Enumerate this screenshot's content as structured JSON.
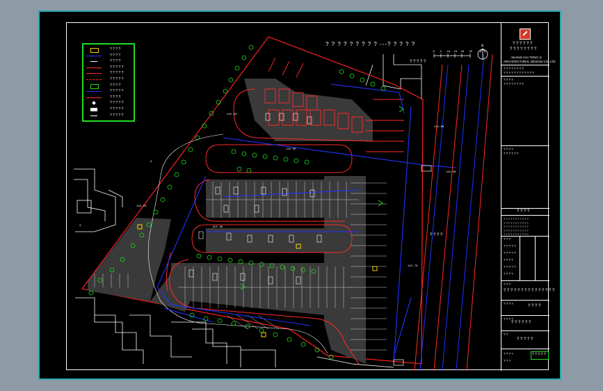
{
  "drawing": {
    "title_line": "? ? ? ? ? ? ? ? ?  ---? ? ? ? ?",
    "scale_labels": [
      "0",
      "5",
      "10",
      "15",
      "20",
      "25"
    ],
    "north_label": "N",
    "road_label_left": "? ? ? ? ?",
    "road_label_right": "? ? ? ?"
  },
  "legend": {
    "items": [
      {
        "sym": "yellow-car",
        "text": "? ? ? ?"
      },
      {
        "sym": "blue-line",
        "text": "? ? ? ?"
      },
      {
        "sym": "white-text",
        "text": "? ? ? ?"
      },
      {
        "sym": "red-line",
        "text": "? ? ? ? ?"
      },
      {
        "sym": "red-line",
        "text": "? ? ? ? ?"
      },
      {
        "sym": "red-dash",
        "text": "? ? ? ? ?"
      },
      {
        "sym": "green-car",
        "text": "? ? ? ?"
      },
      {
        "sym": "blue-line",
        "text": "? ? ? ? ?"
      },
      {
        "sym": "red-small",
        "text": "? ? ? ?"
      },
      {
        "sym": "white-diamond",
        "text": "? ? ? ? ?"
      },
      {
        "sym": "white-rect",
        "text": "? ? ? ? ?"
      },
      {
        "sym": "white-text",
        "text": "? ? ? ? ?"
      }
    ]
  },
  "title_block": {
    "company_line1": "? ? ? ? ? ?",
    "company_line2": "? ? ? ? ? ? ? ?",
    "company_en": "SHANG HAI  TONG JI",
    "company_en2": "ARCHITECTURAL DESIGN CO.,LTD",
    "cert_line1": "? ? ? ? ? ? ? ?",
    "cert_line2": "? ? ? ? ? ? ? ? ? ? ? ?",
    "cert_no": "? ? ? ?",
    "cert_no2": "? ? ? ?   ? ? ? ?",
    "project_label": "? ? ? ?",
    "project_value": "? ? ? ? ? ?",
    "sign_header": "? ? ? ?",
    "sign_rows": [
      "? ? ? ? ? ? ? ? ? ? ?",
      "? ? ? ? ? ? ? ? ? ? ?",
      "? ? ? ? ? ? ? ? ? ? ?",
      "? ? ? ? ? ? ? ? ? ? ?",
      "? ? ? ? ? ? ? ? ? ? ?"
    ],
    "staff_rows": [
      "? ? ?",
      "? ? ? ? ?",
      "? ? ? ? ?",
      "? ? ? ?",
      "? ? ? ? ?",
      "? ? ? ?"
    ],
    "drawing_name_label": "? ? ?",
    "drawing_name_value": "? ? ? ? ? ? ? ? ? ? ? ? ? ? ?",
    "project_no_label": "? ? ? ?",
    "project_no_value": "? ? ? ?",
    "sub_label": "? ? ? ?",
    "sub_value": "? ? ? ? ? ?",
    "stage_label": "? ?",
    "stage_value": "? ? ? ? ?",
    "sheet_no": "? ? ? ?",
    "sheet_id": "? ? ?-? ?",
    "date_label": "? ? ?"
  }
}
